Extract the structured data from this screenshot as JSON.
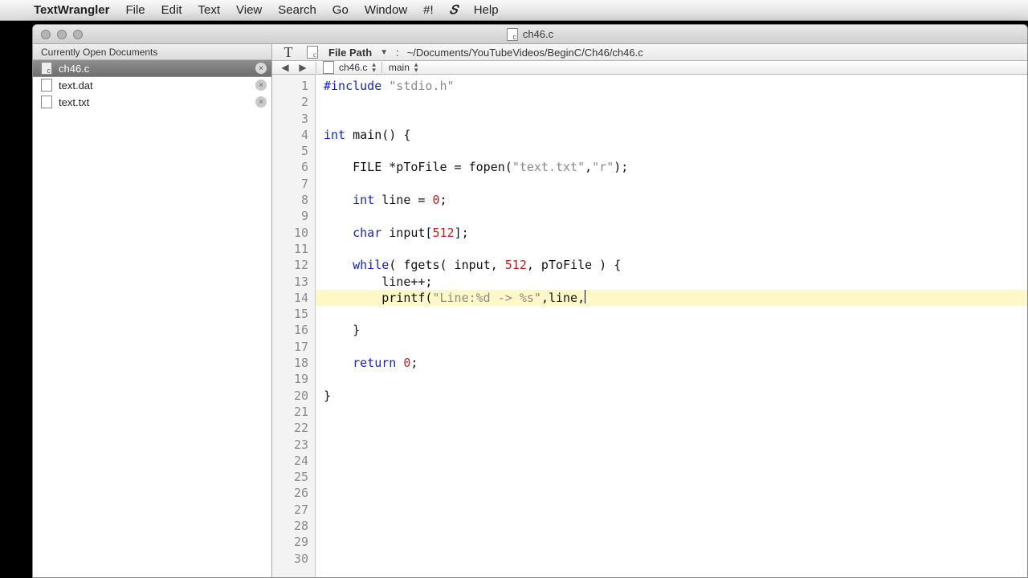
{
  "menubar": {
    "app": "TextWrangler",
    "items": [
      "File",
      "Edit",
      "Text",
      "View",
      "Search",
      "Go",
      "Window",
      "#!"
    ],
    "help": "Help"
  },
  "window": {
    "title": "ch46.c"
  },
  "sidebar": {
    "header": "Currently Open Documents",
    "docs": [
      {
        "name": "ch46.c",
        "active": true
      },
      {
        "name": "text.dat",
        "active": false
      },
      {
        "name": "text.txt",
        "active": false
      }
    ]
  },
  "pathbar": {
    "label": "File Path",
    "crumb": "~/Documents/YouTubeVideos/BeginC/Ch46/ch46.c"
  },
  "navbar": {
    "file": "ch46.c",
    "symbol": "main"
  },
  "code": {
    "lines": [
      {
        "n": 1,
        "seg": [
          [
            "kw",
            "#include "
          ],
          [
            "str",
            "\"stdio.h\""
          ]
        ]
      },
      {
        "n": 2,
        "seg": [
          [
            "",
            ""
          ]
        ]
      },
      {
        "n": 3,
        "seg": [
          [
            "",
            ""
          ]
        ]
      },
      {
        "n": 4,
        "seg": [
          [
            "kw",
            "int"
          ],
          [
            "",
            " main() {"
          ]
        ]
      },
      {
        "n": 5,
        "seg": [
          [
            "",
            ""
          ]
        ]
      },
      {
        "n": 6,
        "seg": [
          [
            "",
            "    FILE *pToFile = fopen("
          ],
          [
            "str",
            "\"text.txt\""
          ],
          [
            "",
            ","
          ],
          [
            "str",
            "\"r\""
          ],
          [
            "",
            ");"
          ]
        ]
      },
      {
        "n": 7,
        "seg": [
          [
            "",
            ""
          ]
        ]
      },
      {
        "n": 8,
        "seg": [
          [
            "",
            "    "
          ],
          [
            "kw",
            "int"
          ],
          [
            "",
            " line = "
          ],
          [
            "num",
            "0"
          ],
          [
            "",
            ";"
          ]
        ]
      },
      {
        "n": 9,
        "seg": [
          [
            "",
            ""
          ]
        ]
      },
      {
        "n": 10,
        "seg": [
          [
            "",
            "    "
          ],
          [
            "kw",
            "char"
          ],
          [
            "",
            " input["
          ],
          [
            "num",
            "512"
          ],
          [
            "",
            "];"
          ]
        ]
      },
      {
        "n": 11,
        "seg": [
          [
            "",
            ""
          ]
        ]
      },
      {
        "n": 12,
        "seg": [
          [
            "",
            "    "
          ],
          [
            "kw",
            "while"
          ],
          [
            "",
            "( fgets( input, "
          ],
          [
            "num",
            "512"
          ],
          [
            "",
            ", pToFile ) {"
          ]
        ]
      },
      {
        "n": 13,
        "seg": [
          [
            "",
            "        line++;"
          ]
        ]
      },
      {
        "n": 14,
        "hl": true,
        "cursor": true,
        "seg": [
          [
            "",
            "        printf("
          ],
          [
            "str",
            "\"Line:%d -> %s\""
          ],
          [
            "",
            ",line,"
          ]
        ]
      },
      {
        "n": 15,
        "seg": [
          [
            "",
            "    }"
          ]
        ]
      },
      {
        "n": 16,
        "seg": [
          [
            "",
            ""
          ]
        ]
      },
      {
        "n": 17,
        "seg": [
          [
            "",
            "    "
          ],
          [
            "kw",
            "return"
          ],
          [
            "",
            " "
          ],
          [
            "num",
            "0"
          ],
          [
            "",
            ";"
          ]
        ]
      },
      {
        "n": 18,
        "seg": [
          [
            "",
            ""
          ]
        ]
      },
      {
        "n": 19,
        "seg": [
          [
            "",
            "}"
          ]
        ]
      },
      {
        "n": 20,
        "seg": [
          [
            "",
            ""
          ]
        ]
      },
      {
        "n": 21,
        "seg": [
          [
            "",
            ""
          ]
        ]
      },
      {
        "n": 22,
        "seg": [
          [
            "",
            ""
          ]
        ]
      },
      {
        "n": 23,
        "seg": [
          [
            "",
            ""
          ]
        ]
      },
      {
        "n": 24,
        "seg": [
          [
            "",
            ""
          ]
        ]
      },
      {
        "n": 25,
        "seg": [
          [
            "",
            ""
          ]
        ]
      },
      {
        "n": 26,
        "seg": [
          [
            "",
            ""
          ]
        ]
      },
      {
        "n": 27,
        "seg": [
          [
            "",
            ""
          ]
        ]
      },
      {
        "n": 28,
        "seg": [
          [
            "",
            ""
          ]
        ]
      },
      {
        "n": 29,
        "seg": [
          [
            "",
            ""
          ]
        ]
      },
      {
        "n": 30,
        "seg": [
          [
            "",
            ""
          ]
        ]
      }
    ]
  }
}
